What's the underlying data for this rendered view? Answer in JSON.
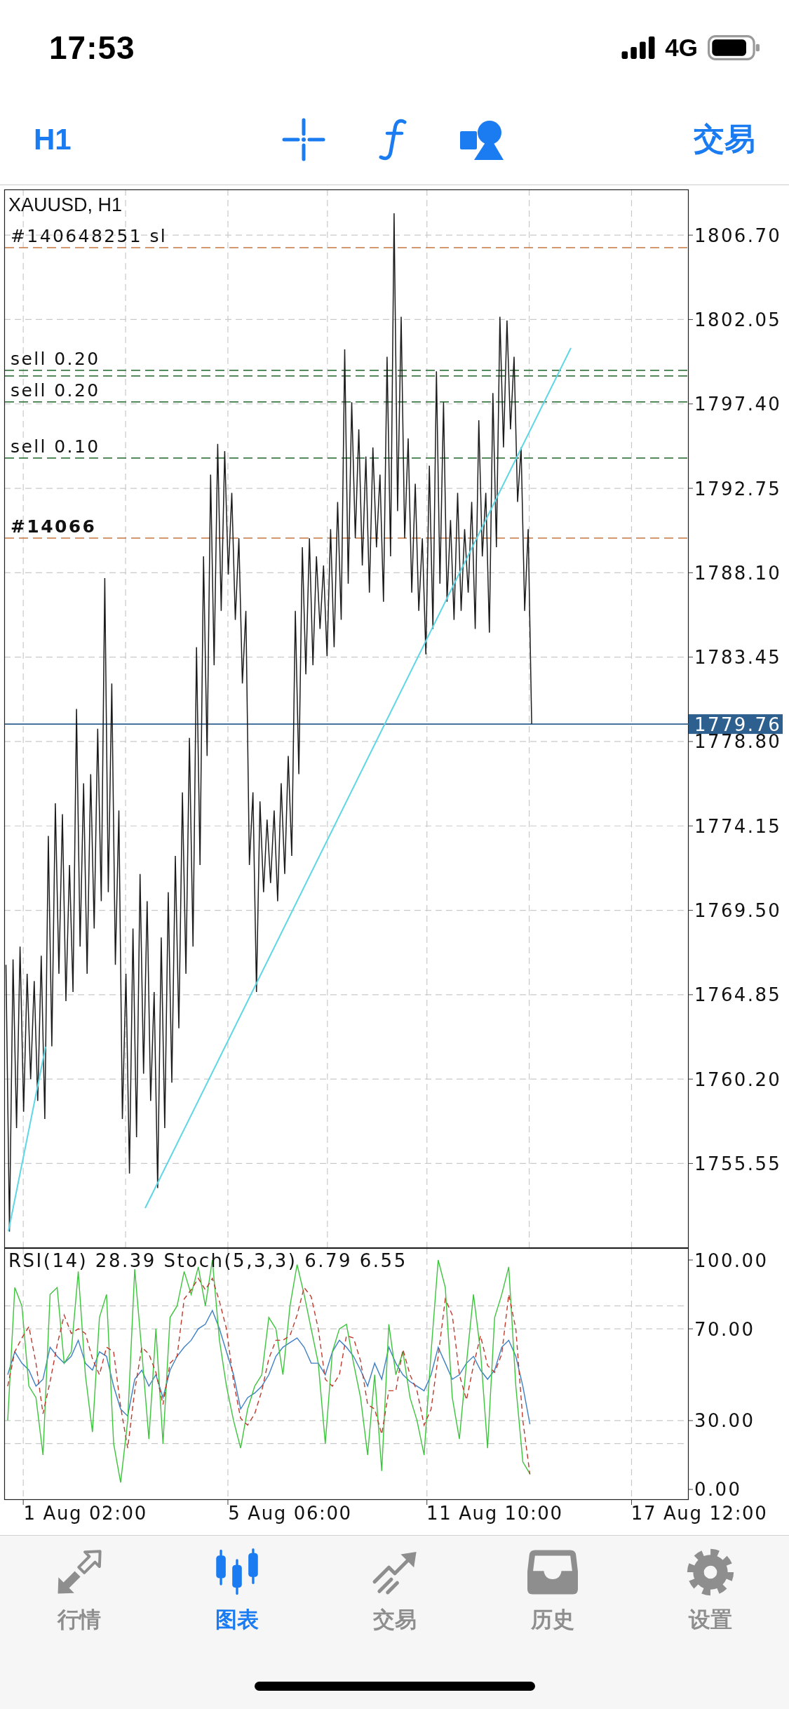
{
  "status_bar": {
    "time": "17:53",
    "network": "4G"
  },
  "toolbar": {
    "timeframe": "H1",
    "trade_button": "交易"
  },
  "chart": {
    "chart_data": {
      "type": "line",
      "title": "XAUUSD, H1",
      "grid": true,
      "categories": [
        null,
        null,
        null,
        null,
        null,
        null,
        null,
        null,
        null,
        null,
        null,
        null,
        null,
        null,
        null,
        null,
        null,
        null,
        null,
        null,
        null,
        null,
        null,
        null,
        null,
        null,
        null,
        null,
        null,
        null,
        null,
        null,
        null,
        null,
        null,
        null,
        null,
        null,
        null,
        null,
        null,
        null,
        null,
        null,
        null,
        null,
        null,
        null,
        null,
        null,
        null,
        null,
        null,
        null,
        null,
        null,
        null,
        null,
        null,
        null,
        null,
        null,
        null,
        null,
        null,
        null,
        null,
        null,
        null,
        null,
        null,
        null,
        null,
        null,
        null,
        null,
        null,
        null,
        null,
        null,
        null,
        null,
        null,
        null,
        null,
        null,
        null,
        null,
        null,
        null,
        null,
        null,
        null,
        null,
        null,
        null,
        null,
        null,
        null,
        null,
        null,
        null,
        null,
        null,
        null,
        null,
        null,
        null,
        null,
        null,
        null,
        null,
        null,
        null,
        null,
        null,
        null,
        null,
        null,
        null,
        null,
        null,
        null,
        null,
        null,
        null,
        null,
        null,
        null,
        null,
        null,
        null,
        null,
        null,
        null,
        null,
        null,
        null,
        null,
        null,
        null,
        null,
        null,
        null,
        null,
        null,
        null,
        null,
        null,
        null,
        null,
        null,
        null,
        null,
        null,
        null,
        null,
        null,
        null,
        null,
        null,
        null,
        null,
        null,
        null,
        null,
        null,
        null,
        null,
        null,
        null,
        null,
        null,
        null,
        null,
        null,
        null,
        null,
        null,
        null,
        null,
        null,
        null,
        null,
        null,
        null,
        null,
        null,
        null,
        null,
        null,
        null,
        null,
        null
      ],
      "values": [
        1766.5,
        1751.8,
        1766.8,
        1757.5,
        1767.5,
        1758.4,
        1766,
        1760.2,
        1765.6,
        1759,
        1767,
        1758,
        1773.6,
        1762,
        1775.4,
        1766,
        1774.8,
        1764.5,
        1772,
        1765,
        1780.6,
        1767.5,
        1776.5,
        1766,
        1777,
        1768.5,
        1779.5,
        1770,
        1787.8,
        1770.5,
        1782,
        1766.5,
        1775,
        1758,
        1766,
        1755,
        1768.5,
        1757,
        1771.5,
        1760.5,
        1770,
        1759,
        1765,
        1754.2,
        1768,
        1757.5,
        1770.5,
        1760,
        1772.5,
        1763,
        1776,
        1766,
        1779,
        1767.5,
        1784,
        1772,
        1789,
        1778,
        1793.5,
        1783,
        1795.2,
        1786,
        1794.8,
        1788,
        1792.5,
        1785.5,
        1790,
        1782,
        1786,
        1772,
        1776,
        1765,
        1775.5,
        1770.5,
        1774.5,
        1771,
        1775,
        1770,
        1776.5,
        1771.5,
        1778,
        1772.5,
        1786,
        1777,
        1789.5,
        1782.5,
        1790,
        1783,
        1789,
        1785,
        1788.5,
        1783.5,
        1790.5,
        1784,
        1792,
        1785.5,
        1800.4,
        1787.5,
        1797.5,
        1790,
        1796,
        1788.5,
        1794.5,
        1787,
        1795,
        1789.5,
        1793.5,
        1786.5,
        1800,
        1789,
        1807.9,
        1791.5,
        1802.2,
        1790,
        1795.5,
        1787,
        1793,
        1786,
        1790,
        1783.6,
        1794,
        1785,
        1799.2,
        1787.5,
        1797.5,
        1786.5,
        1791,
        1785.5,
        1792.5,
        1786,
        1790.5,
        1787,
        1792,
        1785,
        1796.5,
        1789,
        1792.5,
        1784.8,
        1798,
        1789.5,
        1802.2,
        1795,
        1802,
        1796,
        1800,
        1792,
        1795,
        1786,
        1790.5,
        1779.76,
        null,
        null,
        null,
        null,
        null,
        null,
        null,
        null,
        null,
        null,
        null,
        null,
        null,
        null,
        null,
        null,
        null,
        null,
        null,
        null,
        null,
        null,
        null,
        null,
        null,
        null,
        null,
        null,
        null,
        null,
        null,
        null,
        null,
        null,
        null,
        null,
        null,
        null,
        null,
        null,
        null,
        null,
        null,
        null
      ],
      "ylim": [
        1750.89,
        1809.45
      ],
      "yticks": [
        {
          "value": 1806.7,
          "label": "1806.70"
        },
        {
          "value": 1802.05,
          "label": "1802.05"
        },
        {
          "value": 1797.4,
          "label": "1797.40"
        },
        {
          "value": 1792.75,
          "label": "1792.75"
        },
        {
          "value": 1788.1,
          "label": "1788.10"
        },
        {
          "value": 1783.45,
          "label": "1783.45"
        },
        {
          "value": 1778.8,
          "label": "1778.80"
        },
        {
          "value": 1774.15,
          "label": "1774.15"
        },
        {
          "value": 1769.5,
          "label": "1769.50"
        },
        {
          "value": 1764.85,
          "label": "1764.85"
        },
        {
          "value": 1760.2,
          "label": "1760.20"
        },
        {
          "value": 1755.55,
          "label": "1755.55"
        }
      ],
      "ref_lines": [
        {
          "axis": "y",
          "value": 1806.01,
          "label": "#140648251 sl",
          "color": "#c8773e",
          "line_style": "dashed"
        },
        {
          "axis": "y",
          "value": 1799.25,
          "label": "sell 0.20",
          "color": "#3c7a46",
          "line_style": "dashed"
        },
        {
          "axis": "y",
          "value": 1798.94,
          "color": "#3c7a46",
          "line_style": "dashed"
        },
        {
          "axis": "y",
          "value": 1797.51,
          "label": "sell 0.20",
          "color": "#3c7a46",
          "line_style": "dashed"
        },
        {
          "axis": "y",
          "value": 1794.42,
          "label": "sell 0.10",
          "color": "#3c7a46",
          "line_style": "dashed"
        },
        {
          "axis": "y",
          "value": 1790.01,
          "color": "#c8773e",
          "line_style": "dashed"
        },
        {
          "axis": "y",
          "value": 1779.76,
          "label": "1779.76",
          "color": "#2d5f8f",
          "line_style": "solid"
        }
      ]
    },
    "stacked_order_label": "#14066"
  },
  "indicator_panel": {
    "chart_data": {
      "type": "line",
      "title": "RSI(14) 28.39 Stoch(5,3,3) 6.79 6.55",
      "grid": true,
      "categories": [
        null,
        null,
        null,
        null,
        null,
        null,
        null,
        null,
        null,
        null,
        null,
        "1 Aug 02:00",
        null,
        null,
        null,
        null,
        null,
        null,
        null,
        null,
        null,
        null,
        null,
        null,
        null,
        null,
        null,
        null,
        null,
        null,
        null,
        null,
        null,
        null,
        null,
        null,
        null,
        null,
        null,
        null,
        "5 Aug 06:00",
        null,
        null,
        null,
        null,
        null,
        null,
        null,
        null,
        null,
        null,
        null,
        null,
        null,
        null,
        null,
        null,
        null,
        null,
        null,
        null,
        null,
        null,
        null,
        null,
        null,
        null,
        null,
        null,
        "11 Aug 10:00",
        null,
        null,
        null,
        null,
        null,
        null,
        null,
        null,
        null,
        null,
        null,
        null,
        null,
        null,
        null,
        null,
        null,
        null,
        null,
        null,
        null,
        null,
        null,
        null,
        null,
        null,
        null,
        null,
        "17 Aug 12:00"
      ],
      "series": [
        {
          "color": "#3d7fc4",
          "values": [
            50,
            60,
            55,
            52,
            45,
            48,
            62,
            58,
            55,
            58,
            65,
            55,
            52,
            60,
            58,
            45,
            35,
            32,
            48,
            52,
            45,
            50,
            40,
            52,
            58,
            62,
            65,
            70,
            72,
            78,
            70,
            60,
            50,
            35,
            40,
            42,
            45,
            50,
            58,
            62,
            64,
            66,
            62,
            55,
            55,
            50,
            60,
            65,
            62,
            58,
            52,
            45,
            55,
            48,
            62,
            55,
            50,
            47,
            45,
            43,
            50,
            62,
            55,
            48,
            50,
            55,
            58,
            52,
            48,
            52,
            62,
            65,
            58,
            45,
            28.39,
            null,
            null,
            null,
            null,
            null,
            null,
            null,
            null,
            null,
            null,
            null,
            null,
            null,
            null,
            null,
            null,
            null,
            null,
            null,
            null,
            null,
            null,
            null,
            null
          ]
        },
        {
          "color": "#3cc43c",
          "values": [
            30,
            88,
            80,
            45,
            40,
            15,
            85,
            88,
            55,
            60,
            95,
            50,
            25,
            75,
            85,
            20,
            3,
            30,
            96,
            60,
            22,
            70,
            20,
            75,
            80,
            95,
            85,
            97,
            80,
            100,
            65,
            45,
            30,
            18,
            35,
            45,
            50,
            75,
            70,
            50,
            80,
            98,
            85,
            70,
            55,
            20,
            60,
            70,
            72,
            55,
            40,
            15,
            50,
            8,
            72,
            50,
            60,
            40,
            30,
            15,
            60,
            100,
            88,
            40,
            22,
            55,
            85,
            60,
            18,
            75,
            85,
            97,
            45,
            12,
            6.79,
            null,
            null,
            null,
            null,
            null,
            null,
            null,
            null,
            null,
            null,
            null,
            null,
            null,
            null,
            null,
            null,
            null,
            null,
            null,
            null,
            null,
            null,
            null,
            null
          ]
        },
        {
          "color": "#c0392b",
          "line_style": "dashed",
          "values": [
            45,
            60,
            66,
            71,
            55,
            33,
            47,
            63,
            76,
            68,
            70,
            68,
            57,
            50,
            62,
            60,
            36,
            18,
            43,
            62,
            59,
            51,
            37,
            55,
            58,
            83,
            87,
            92,
            87,
            92,
            82,
            70,
            47,
            31,
            28,
            33,
            43,
            57,
            65,
            65,
            67,
            76,
            88,
            84,
            70,
            48,
            45,
            50,
            67,
            66,
            56,
            37,
            35,
            24,
            43,
            43,
            61,
            50,
            43,
            28,
            35,
            58,
            83,
            76,
            50,
            39,
            54,
            67,
            54,
            51,
            59,
            85,
            70,
            30,
            6.55,
            null,
            null,
            null,
            null,
            null,
            null,
            null,
            null,
            null,
            null,
            null,
            null,
            null,
            null,
            null,
            null,
            null,
            null,
            null,
            null,
            null,
            null,
            null,
            null
          ]
        }
      ],
      "ylim": [
        -4.59,
        105.2
      ],
      "yticks": [
        {
          "value": 100,
          "label": "100.00"
        },
        {
          "value": 70,
          "label": "70.00"
        },
        {
          "value": 30,
          "label": "30.00"
        },
        {
          "value": 0,
          "label": "0.00"
        }
      ]
    }
  },
  "tab_bar": {
    "tabs": [
      {
        "label": "行情",
        "selected": false
      },
      {
        "label": "图表",
        "selected": true
      },
      {
        "label": "交易",
        "selected": false
      },
      {
        "label": "历史",
        "selected": false
      },
      {
        "label": "设置",
        "selected": false
      }
    ]
  }
}
